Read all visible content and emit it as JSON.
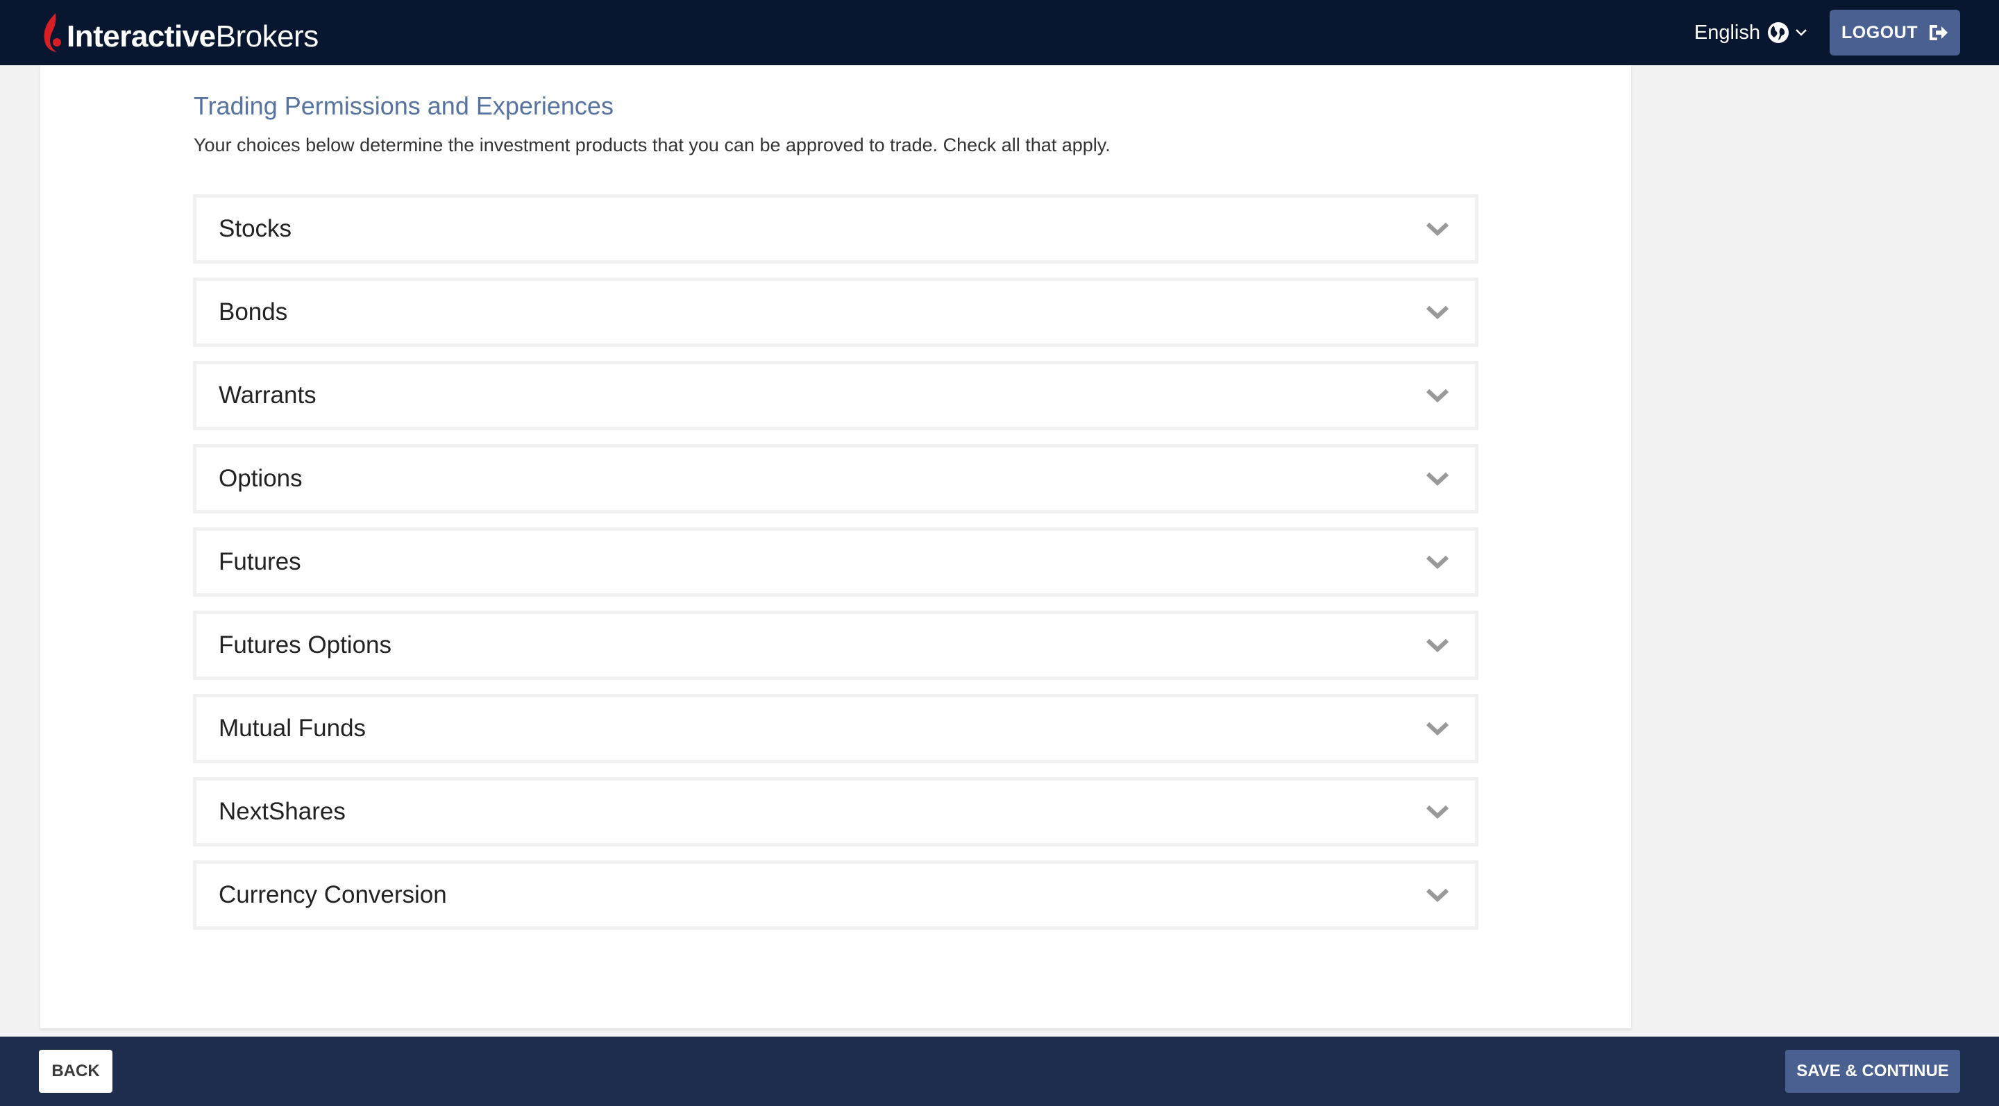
{
  "header": {
    "logo": {
      "part_bold": "Interactive",
      "part_regular": "Brokers",
      "mark_color": "#d81f26"
    },
    "language": {
      "label": "English",
      "icon": "globe-icon"
    },
    "logout_label": "LOGOUT",
    "logout_icon": "sign-out-icon"
  },
  "main": {
    "title": "Trading Permissions and Experiences",
    "description": "Your choices below determine the investment products that you can be approved to trade. Check all that apply.",
    "products": [
      {
        "label": "Stocks"
      },
      {
        "label": "Bonds"
      },
      {
        "label": "Warrants"
      },
      {
        "label": "Options"
      },
      {
        "label": "Futures"
      },
      {
        "label": "Futures Options"
      },
      {
        "label": "Mutual Funds"
      },
      {
        "label": "NextShares"
      },
      {
        "label": "Currency Conversion"
      }
    ]
  },
  "footer": {
    "back_label": "BACK",
    "save_label": "SAVE & CONTINUE"
  },
  "colors": {
    "header_bg": "#081630",
    "footer_bg": "#1e2d4d",
    "accent_button": "#4a6090",
    "title_text": "#5673a0"
  }
}
